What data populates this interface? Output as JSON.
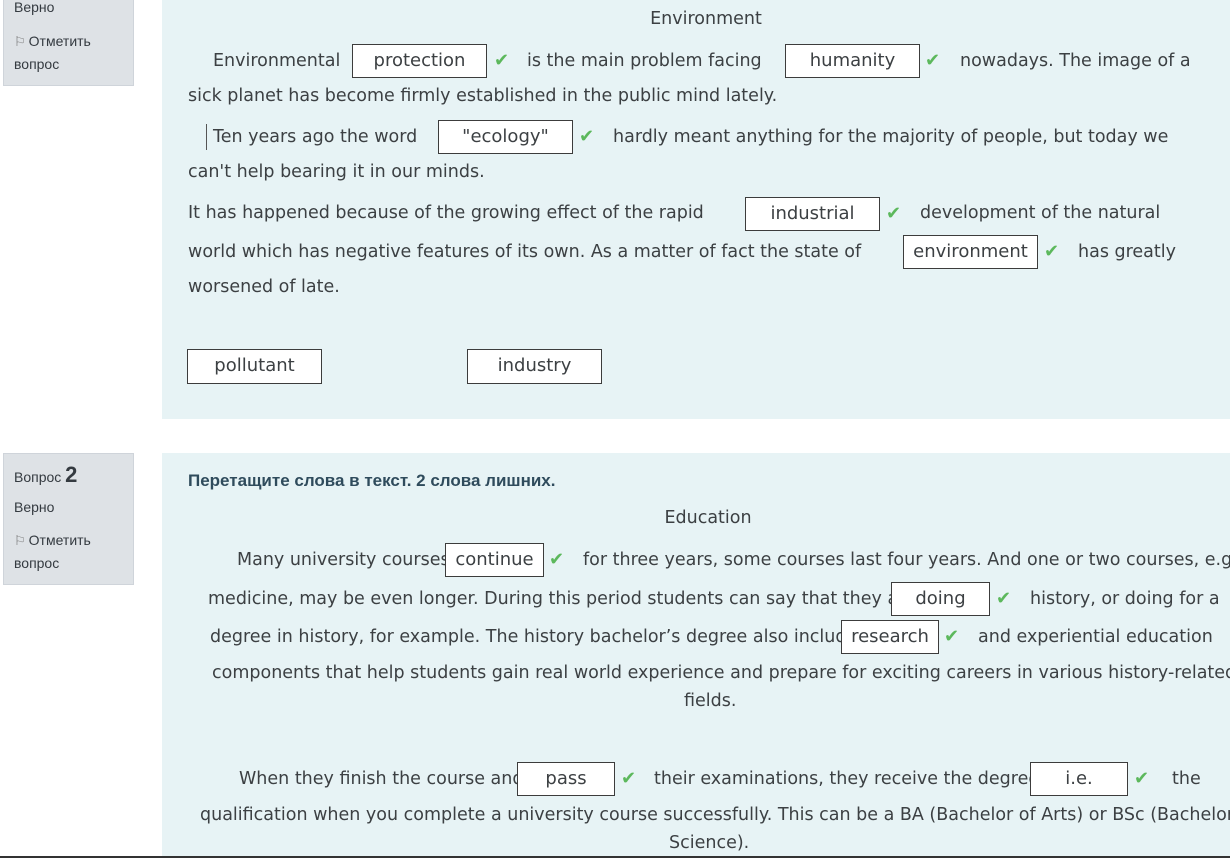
{
  "q1": {
    "state": "Верно",
    "flag_line1": "Отметить",
    "flag_line2": "вопрос",
    "title": "Environment",
    "l1a": "Environmental",
    "d1": "protection",
    "l1b": "is the main problem facing",
    "d2": "humanity",
    "l1c": "nowadays. The image of a",
    "l2": "sick planet has become firmly established in the public mind lately.",
    "l3a": "Ten years ago the word",
    "d3": "\"ecology\"",
    "l3b": "hardly meant anything for the majority of people, but today we",
    "l4": "can't help bearing it in our minds.",
    "l5a": "It has happened because of the growing effect of the rapid",
    "d4": "industrial",
    "l5b": "development of the natural",
    "l6a": "world which has negative features of its own. As a matter of fact the state of",
    "d5": "environment",
    "l6b": "has greatly",
    "l7": "worsened of late.",
    "choices": [
      "pollutant",
      "industry"
    ]
  },
  "q2": {
    "label": "Вопрос",
    "number": "2",
    "state": "Верно",
    "flag_line1": "Отметить",
    "flag_line2": "вопрос",
    "prompt": "Перетащите слова в текст. 2 слова лишних.",
    "title": "Education",
    "p1a": "Many university courses",
    "d1": "continue",
    "p1b": "for three years, some courses last four years. And one or two courses, e.g.",
    "p2a": "medicine, may be even longer. During this period students can say that they are",
    "d2": "doing",
    "p2b": "history, or doing for a",
    "p3a": "degree in history, for example. The history bachelor’s degree also includes",
    "d3": "research",
    "p3b": "and experiential education",
    "p4": "components that help students gain real world experience and prepare for exciting careers in various history-related",
    "p5": "fields.",
    "p6a": "When they finish the course and",
    "d4": "pass",
    "p6b": "their examinations, they receive the degree,",
    "d5": "i.e.",
    "p6c": "the",
    "p7": "qualification when you complete a university course successfully. This can be a BA (Bachelor of Arts) or BSc (Bachelor of",
    "p8": "Science)."
  },
  "icons": {
    "check": "check-icon",
    "flag": "flag-icon"
  },
  "colors": {
    "content_bg": "#e7f3f5",
    "info_bg": "#dee2e6",
    "check": "#5cb85c"
  }
}
